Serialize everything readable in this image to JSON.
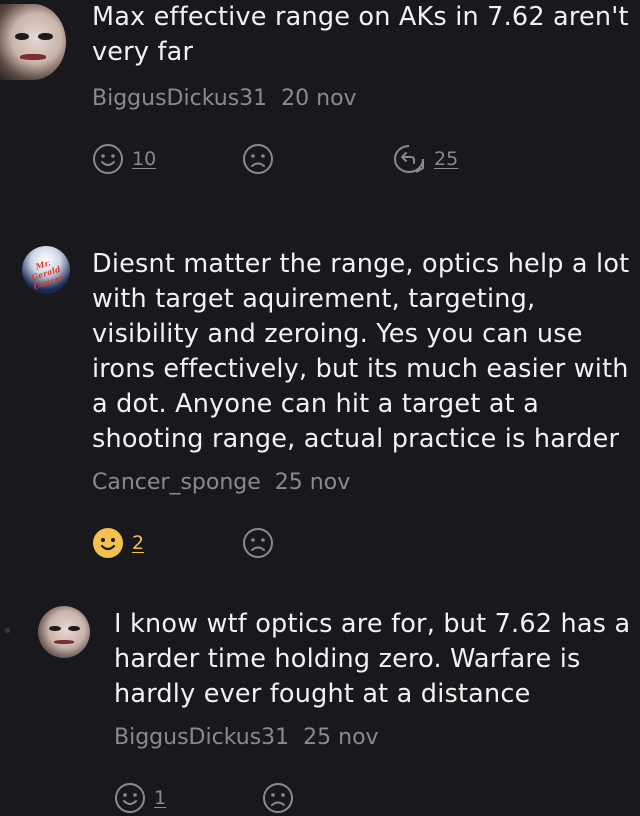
{
  "comments": [
    {
      "text": "Max effective range on AKs in 7.62 aren't very far",
      "author": "BiggusDickus31",
      "date": "20 nov",
      "upvotes": "10",
      "replies": "25",
      "avatar": "face-paint-avatar"
    },
    {
      "text": "Diesnt matter the range, optics help a lot with target aquirement, targeting, visibility and zeroing. Yes you can use irons effectively, but its much easier with a dot. Anyone can hit a target at a shooting range, actual practice is harder",
      "author": "Cancer_sponge",
      "date": "25 nov",
      "upvotes": "2",
      "avatar": "badge-avatar",
      "avatar_text": "Mr. Gerald Cancer"
    },
    {
      "text": "I know wtf optics are for, but 7.62 has a harder time holding zero. Warfare is hardly ever fought at a distance",
      "author": "BiggusDickus31",
      "date": "25 nov",
      "upvotes": "1",
      "avatar": "face-paint-avatar"
    }
  ],
  "colors": {
    "background": "#19181d",
    "text": "#f2f2f2",
    "muted": "#8a8990",
    "active_like": "#f2c14e"
  }
}
